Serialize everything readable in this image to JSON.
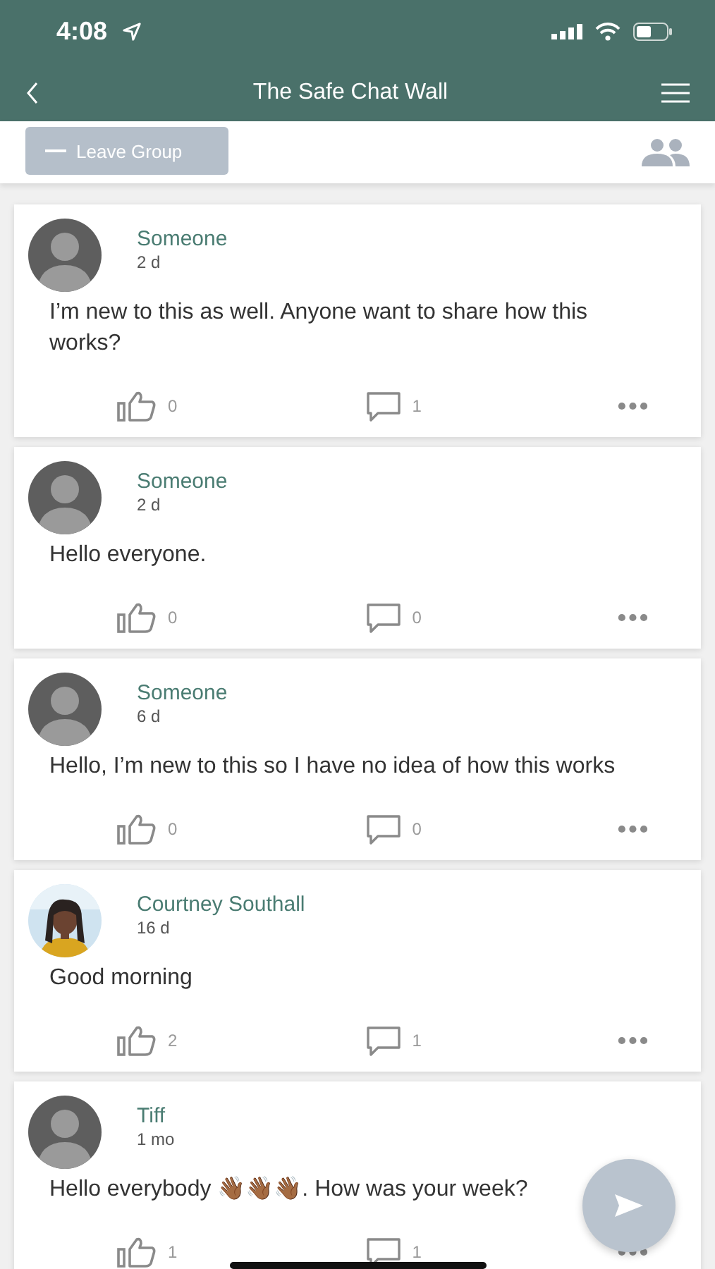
{
  "status_bar": {
    "time": "4:08"
  },
  "nav": {
    "title": "The Safe Chat Wall"
  },
  "toolbar": {
    "leave_button": "Leave Group"
  },
  "posts": [
    {
      "author": "Someone",
      "time": "2 d",
      "kind": "default",
      "text": "I’m new to this as well. Anyone want to share how this works?",
      "likes": "0",
      "comments": "1"
    },
    {
      "author": "Someone",
      "time": "2 d",
      "kind": "default",
      "text": "Hello everyone.",
      "likes": "0",
      "comments": "0"
    },
    {
      "author": "Someone",
      "time": "6 d",
      "kind": "default",
      "text": "Hello, I’m new to this so I have no idea of how this works",
      "likes": "0",
      "comments": "0"
    },
    {
      "author": "Courtney Southall",
      "time": "16 d",
      "kind": "picture",
      "text": "Good morning",
      "likes": "2",
      "comments": "1"
    },
    {
      "author": "Tiff",
      "time": "1 mo",
      "kind": "default",
      "text": "Hello everybody 👋🏾👋🏾👋🏾. How was your week?",
      "likes": "1",
      "comments": "1"
    }
  ]
}
